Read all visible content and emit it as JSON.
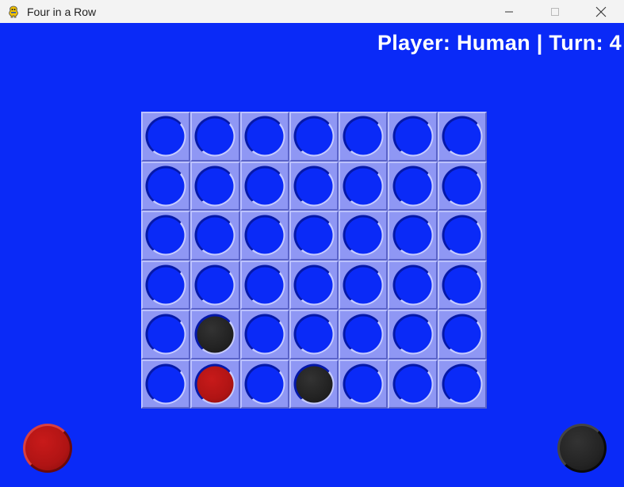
{
  "window": {
    "title": "Four in a Row",
    "app_icon": "pygame-snake-icon",
    "controls": [
      "minimize-icon",
      "maximize-icon",
      "close-icon"
    ]
  },
  "status": {
    "text": "Player: Human | Turn: 4",
    "color": "#ffffff"
  },
  "board": {
    "columns": 7,
    "rows": 6,
    "cells": [
      [
        "empty",
        "empty",
        "empty",
        "empty",
        "empty",
        "empty",
        "empty"
      ],
      [
        "empty",
        "empty",
        "empty",
        "empty",
        "empty",
        "empty",
        "empty"
      ],
      [
        "empty",
        "empty",
        "empty",
        "empty",
        "empty",
        "empty",
        "empty"
      ],
      [
        "empty",
        "empty",
        "empty",
        "empty",
        "empty",
        "empty",
        "empty"
      ],
      [
        "empty",
        "black",
        "empty",
        "empty",
        "empty",
        "empty",
        "empty"
      ],
      [
        "empty",
        "red",
        "empty",
        "black",
        "empty",
        "empty",
        "empty"
      ]
    ]
  },
  "token_piles": {
    "left": "red",
    "right": "black"
  },
  "colors": {
    "background": "#0a2af7",
    "board_cell": "#8f97f4",
    "red_token": "#b01414",
    "black_token": "#242424"
  }
}
